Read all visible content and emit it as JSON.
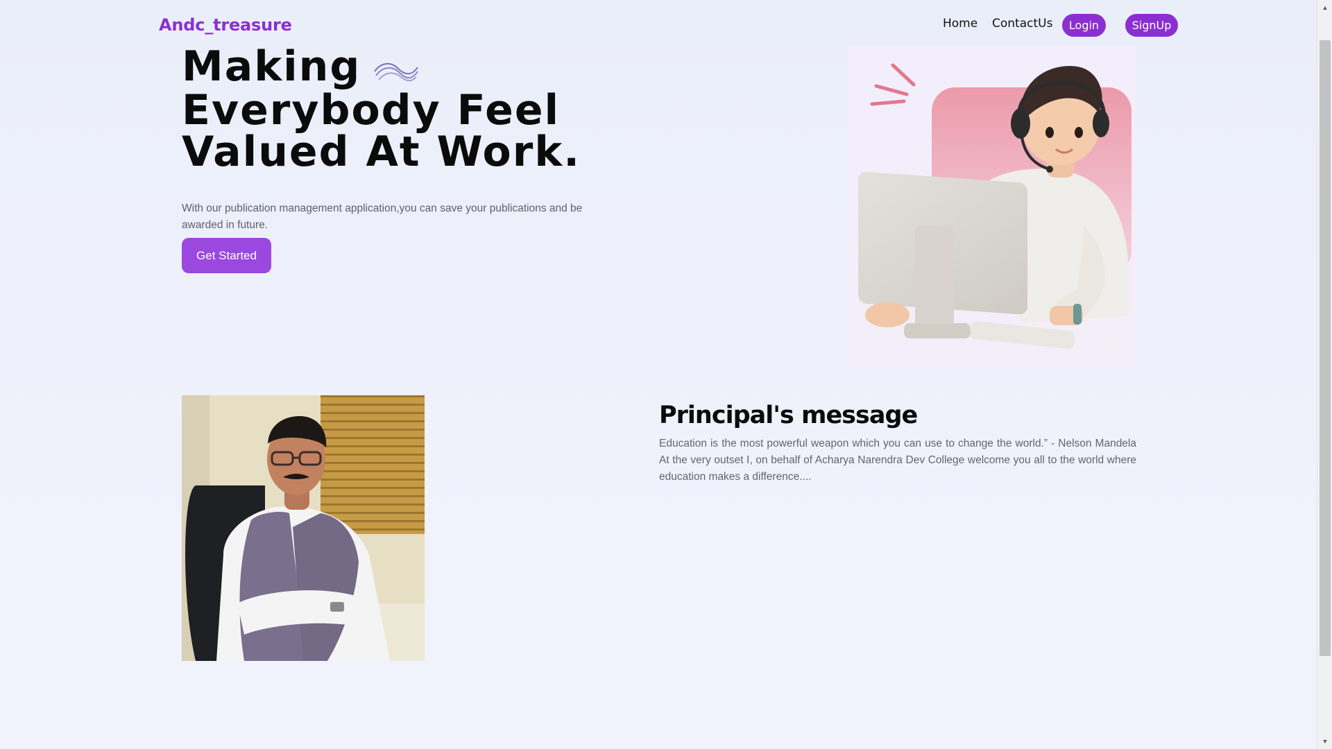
{
  "nav": {
    "brand": "Andc_treasure",
    "home": "Home",
    "contact": "ContactUs",
    "login": "Login",
    "signup": "SignUp"
  },
  "hero": {
    "title_line1": "Making",
    "title_line2": "Everybody Feel",
    "title_line3": "Valued At Work.",
    "subtitle": "With our publication management application,you can save your publications and be awarded in future.",
    "cta": "Get Started"
  },
  "principal": {
    "title": "Principal's message",
    "body": "Education is the most powerful weapon which you can use to change the world.” - Nelson Mandela At the very outset I, on behalf of Acharya Narendra Dev College welcome you all to the world where education makes a difference...."
  },
  "colors": {
    "brand": "#8a2fd1",
    "cta": "#9a48de",
    "background": "#eef1fb"
  },
  "icons": {
    "hero_decoration": "wave-lines-icon",
    "scroll_up": "arrow-up-icon",
    "scroll_down": "arrow-down-icon"
  }
}
